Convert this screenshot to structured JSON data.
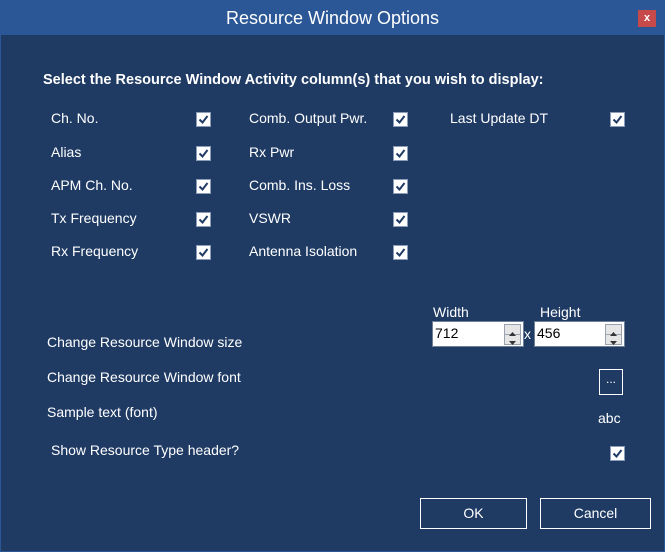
{
  "window": {
    "title": "Resource Window Options",
    "close_label": "x"
  },
  "heading": "Select the Resource Window Activity column(s) that you wish to display:",
  "columns": [
    {
      "label": "Ch. No.",
      "checked": true
    },
    {
      "label": "Alias",
      "checked": true
    },
    {
      "label": "APM Ch. No.",
      "checked": true
    },
    {
      "label": "Tx Frequency",
      "checked": true
    },
    {
      "label": "Rx Frequency",
      "checked": true
    },
    {
      "label": "Comb. Output Pwr.",
      "checked": true
    },
    {
      "label": "Rx Pwr",
      "checked": true
    },
    {
      "label": "Comb. Ins. Loss",
      "checked": true
    },
    {
      "label": "VSWR",
      "checked": true
    },
    {
      "label": "Antenna Isolation",
      "checked": true
    },
    {
      "label": "Last Update DT",
      "checked": true
    }
  ],
  "size": {
    "label": "Change Resource Window size",
    "width_label": "Width",
    "height_label": "Height",
    "width_value": "712",
    "height_value": "456",
    "separator": "x"
  },
  "font": {
    "label": "Change Resource Window font",
    "button_label": "...",
    "sample_label": "Sample text (font)",
    "sample_text": "abc"
  },
  "header_toggle": {
    "label": "Show Resource Type header?",
    "checked": true
  },
  "buttons": {
    "ok": "OK",
    "cancel": "Cancel"
  },
  "colors": {
    "background": "#1f3b64",
    "titlebar": "#2b5797",
    "close": "#c74a4a"
  }
}
